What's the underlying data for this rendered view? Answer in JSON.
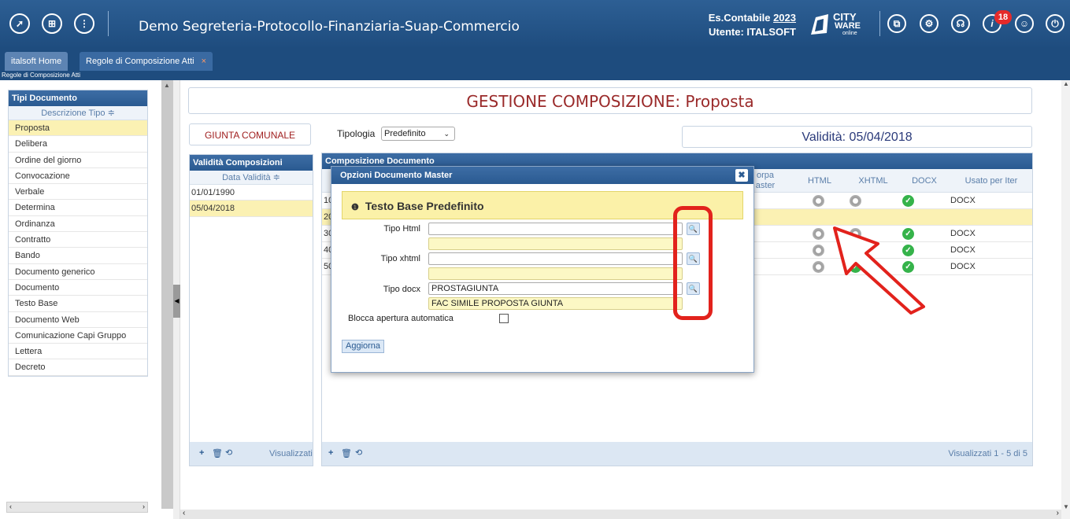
{
  "header": {
    "app_title": "Demo Segreteria-Protocollo-Finanziaria-Suap-Commercio",
    "es_contabile_label": "Es.Contabile ",
    "es_contabile_year": "2023",
    "utente": "Utente: ITALSOFT",
    "logo_top": "CITY",
    "logo_mid": "WARE",
    "logo_bottom": "online",
    "notification_count": "18"
  },
  "tabs": [
    {
      "label": "italsoft Home"
    },
    {
      "label": "Regole di Composizione Atti",
      "close": "×"
    }
  ],
  "breadcrumb": "Regole di Composizione Atti",
  "sidebar": {
    "title": "Tipi Documento",
    "column": "Descrizione Tipo ≑",
    "items": [
      {
        "label": "Proposta",
        "selected": true
      },
      {
        "label": "Delibera"
      },
      {
        "label": "Ordine del giorno"
      },
      {
        "label": "Convocazione"
      },
      {
        "label": "Verbale"
      },
      {
        "label": "Determina"
      },
      {
        "label": "Ordinanza"
      },
      {
        "label": "Contratto"
      },
      {
        "label": "Bando"
      },
      {
        "label": "Documento generico"
      },
      {
        "label": "Documento"
      },
      {
        "label": "Testo Base"
      },
      {
        "label": "Documento Web"
      },
      {
        "label": "Comunicazione Capi Gruppo"
      },
      {
        "label": "Lettera"
      },
      {
        "label": "Decreto"
      }
    ]
  },
  "main": {
    "title": "GESTIONE COMPOSIZIONE: Proposta",
    "giunta": "GIUNTA COMUNALE",
    "tipologia_label": "Tipologia",
    "tipologia_value": "Predefinito",
    "validita": "Validità: 05/04/2018",
    "val_panel": {
      "title": "Validità Composizioni",
      "column": "Data Validità ≑",
      "rows": [
        "01/01/1990",
        "05/04/2018"
      ],
      "footer_label": "Visualizzati"
    },
    "comp_panel": {
      "title": "Composizione Documento",
      "columns": {
        "master_part1": "orpa",
        "master_part2": "aster",
        "html": "HTML",
        "xhtml": "XHTML",
        "docx": "DOCX",
        "usato": "Usato per Iter"
      },
      "row_codes": [
        "10",
        "20",
        "30",
        "40",
        "50"
      ],
      "usato_values": [
        "DOCX",
        "",
        "DOCX",
        "DOCX",
        "DOCX"
      ],
      "footer_status": "Visualizzati 1 - 5 di 5"
    }
  },
  "dialog": {
    "title": "Opzioni Documento Master",
    "info_title": "Testo Base Predefinito",
    "html_label": "Tipo Html",
    "html_value": "",
    "html_desc": "",
    "xhtml_label": "Tipo xhtml",
    "xhtml_value": "",
    "xhtml_desc": "",
    "docx_label": "Tipo docx",
    "docx_value": "PROSTAGIUNTA",
    "docx_desc": "FAC SIMILE PROPOSTA GIUNTA",
    "blocca_label": "Blocca apertura automatica",
    "aggiorna_label": "Aggiorna"
  },
  "colors": {
    "header_bg": "#1e4c7e",
    "title_red": "#9a2a2a",
    "selected_row": "#fbf1b3",
    "annotation_red": "#e2221c",
    "check_green": "#35b34a"
  }
}
